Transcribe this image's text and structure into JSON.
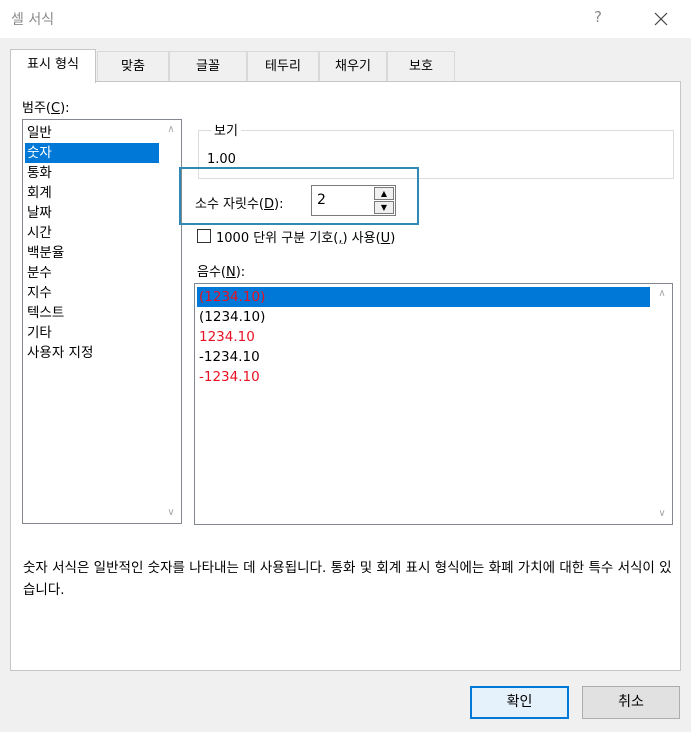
{
  "window": {
    "title": "셀 서식",
    "help_label": "?"
  },
  "tabs": [
    {
      "label": "표시 형식",
      "active": true
    },
    {
      "label": "맞춤",
      "active": false
    },
    {
      "label": "글꼴",
      "active": false
    },
    {
      "label": "테두리",
      "active": false
    },
    {
      "label": "채우기",
      "active": false
    },
    {
      "label": "보호",
      "active": false
    }
  ],
  "category": {
    "label_prefix": "범주(",
    "label_key": "C",
    "label_suffix": "):",
    "items": [
      "일반",
      "숫자",
      "통화",
      "회계",
      "날짜",
      "시간",
      "백분율",
      "분수",
      "지수",
      "텍스트",
      "기타",
      "사용자 지정"
    ],
    "selected_index": 1
  },
  "preview": {
    "legend": "보기",
    "value": "1.00"
  },
  "decimal_places": {
    "label_prefix": "소수 자릿수(",
    "label_key": "D",
    "label_suffix": "):",
    "value": "2"
  },
  "thousand_separator": {
    "label_prefix": "1000 단위 구분 기호(",
    "label_key": ",",
    "label_mid": ") 사용(",
    "label_key2": "U",
    "label_suffix": ")",
    "checked": false
  },
  "negative_numbers": {
    "label_prefix": "음수(",
    "label_key": "N",
    "label_suffix": "):",
    "items": [
      {
        "text": "(1234.10)",
        "color": "#e81123",
        "selected": true
      },
      {
        "text": "(1234.10)",
        "color": "#000000",
        "selected": false
      },
      {
        "text": "1234.10",
        "color": "#e81123",
        "selected": false
      },
      {
        "text": "-1234.10",
        "color": "#000000",
        "selected": false
      },
      {
        "text": "-1234.10",
        "color": "#e81123",
        "selected": false
      }
    ]
  },
  "description": {
    "text": "숫자 서식은 일반적인 숫자를 나타내는 데 사용됩니다. 통화 및 회계 표시 형식에는 화폐 가치에 대한 특수 서식이 있습니다."
  },
  "buttons": {
    "ok": "확인",
    "cancel": "취소"
  },
  "colors": {
    "accent": "#0078d7",
    "highlight_frame": "#2e8ab5"
  }
}
